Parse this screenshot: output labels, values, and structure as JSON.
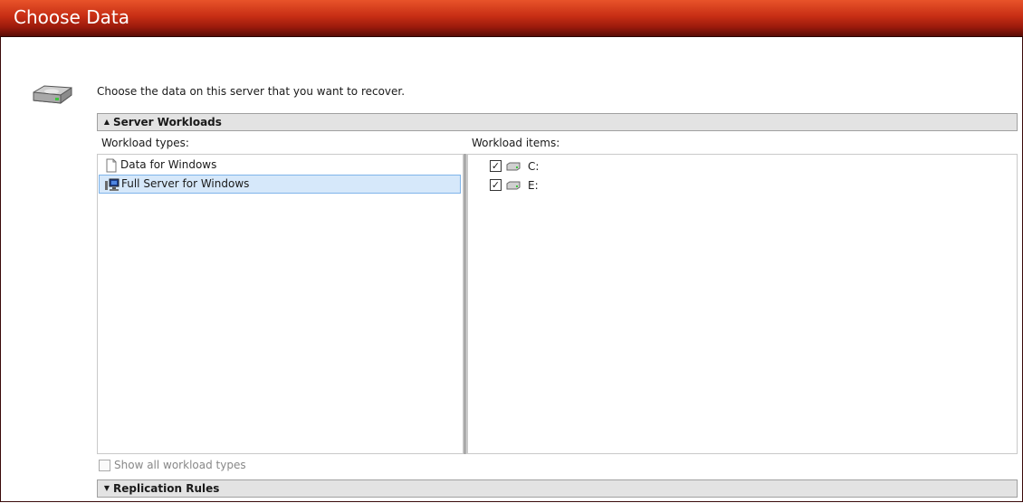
{
  "window": {
    "title": "Choose Data"
  },
  "instruction": "Choose the data on this server that you want to recover.",
  "workloads_section": {
    "title": "Server Workloads",
    "expanded": true,
    "types_label": "Workload types:",
    "items_label": "Workload items:",
    "types": [
      {
        "label": "Data for Windows",
        "icon": "document-icon",
        "selected": false
      },
      {
        "label": "Full Server for Windows",
        "icon": "server-icon",
        "selected": true
      }
    ],
    "items": [
      {
        "label": "C:",
        "checked": true,
        "icon": "disk-drive-icon"
      },
      {
        "label": "E:",
        "checked": true,
        "icon": "disk-drive-icon"
      }
    ],
    "show_all_label": "Show all workload types",
    "show_all_checked": false
  },
  "replication_section": {
    "title": "Replication Rules",
    "expanded": false
  },
  "colors": {
    "title_bar": "#c72e14",
    "selection": "#d6e8fa",
    "section_header": "#e3e3e3"
  }
}
